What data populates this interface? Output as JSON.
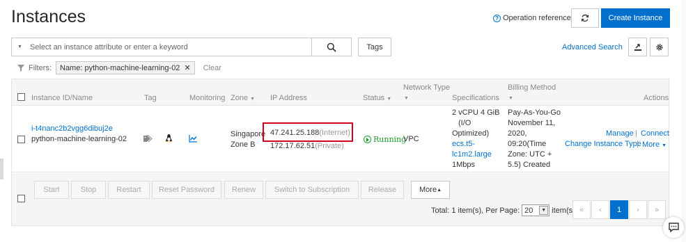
{
  "header": {
    "title": "Instances",
    "operation_reference": "Operation reference",
    "create_instance": "Create Instance"
  },
  "toolbar": {
    "search_placeholder": "Select an instance attribute or enter a keyword",
    "tags": "Tags",
    "advanced_search": "Advanced Search"
  },
  "filters": {
    "label": "Filters:",
    "chip": "Name: python-machine-learning-02",
    "clear": "Clear"
  },
  "table": {
    "headers": {
      "instance": "Instance ID/Name",
      "tag": "Tag",
      "monitoring": "Monitoring",
      "zone": "Zone",
      "ip": "IP Address",
      "status": "Status",
      "network": "Network Type",
      "specs": "Specifications",
      "billing": "Billing Method",
      "actions": "Actions"
    },
    "row": {
      "instance_id": "i-t4nanc2b2vgg6dibuj2e",
      "instance_name": "python-machine-learning-02",
      "zone_line1": "Singapore",
      "zone_line2": "Zone B",
      "ip_internet": "47.241.25.188",
      "ip_internet_suffix": "(Internet)",
      "ip_private": "172.17.62.51",
      "ip_private_suffix": "(Private)",
      "status": "Running",
      "network": "VPC",
      "spec_line1": "2 vCPU 4 GiB",
      "spec_line2": "(I/O",
      "spec_line3": "Optimized)",
      "spec_link1": "ecs.t5-",
      "spec_link2": "lc1m2.large",
      "spec_bw": "1Mbps",
      "billing_line1": "Pay-As-You-Go",
      "billing_line2": "November 11,",
      "billing_line3": "2020,",
      "billing_line4": "09:20(Time",
      "billing_line5": "Zone: UTC +",
      "billing_line6": "5.5) Created",
      "action_manage": "Manage",
      "action_connect": "Connect",
      "action_change": "Change Instance Type",
      "action_more": "More"
    }
  },
  "footer": {
    "start": "Start",
    "stop": "Stop",
    "restart": "Restart",
    "reset_password": "Reset Password",
    "renew": "Renew",
    "switch_subscription": "Switch to Subscription",
    "release": "Release",
    "more": "More",
    "total_prefix": "Total: 1 item(s), Per Page:",
    "per_page": "20",
    "items_suffix": "item(s)",
    "page_first": "«",
    "page_prev": "‹",
    "page_current": "1",
    "page_next": "›",
    "page_last": "»"
  },
  "colors": {
    "primary": "#0070cc",
    "running": "#1e9a2c",
    "highlight": "#d0021b"
  }
}
